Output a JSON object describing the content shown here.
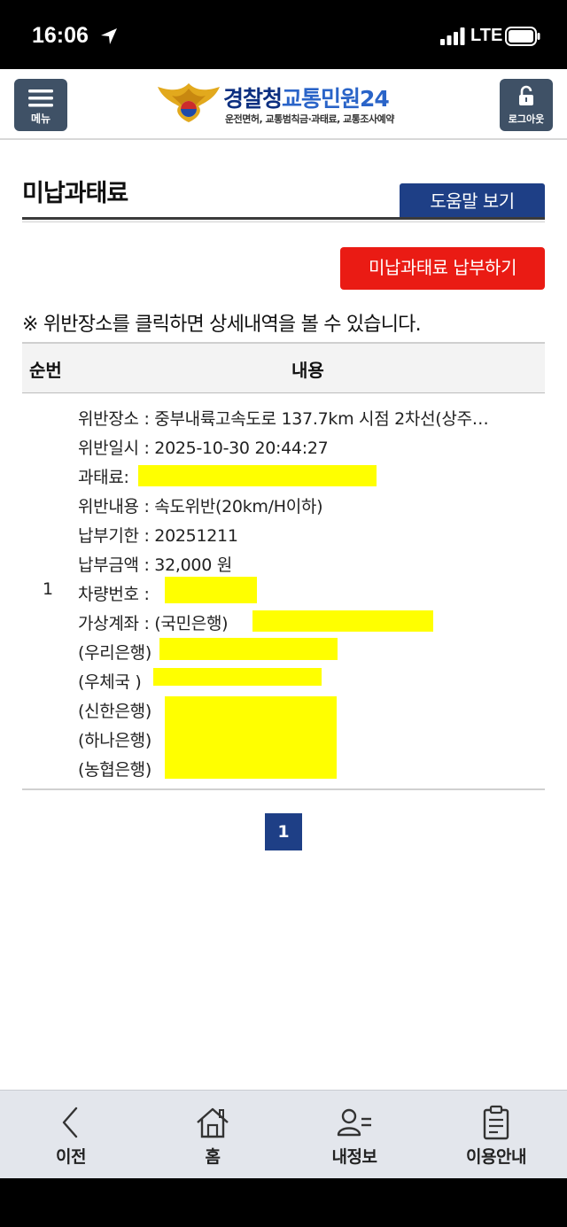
{
  "status": {
    "time": "16:06",
    "network": "LTE"
  },
  "header": {
    "menu_label": "메뉴",
    "logo_title_1": "경찰청",
    "logo_title_2": "교통민원24",
    "logo_subtitle": "운전면허, 교통범칙금·과태료, 교통조사예약",
    "logout_label": "로그아웃"
  },
  "page": {
    "title": "미납과태료",
    "help_label": "도움말 보기",
    "pay_label": "미납과태료 납부하기",
    "notice": "※ 위반장소를 클릭하면 상세내역을 볼 수 있습니다."
  },
  "table": {
    "col_no": "순번",
    "col_content": "내용",
    "row_no": "1",
    "place": "위반장소 : 중부내륙고속도로 137.7km 시점 2차선(상주…",
    "datetime": "위반일시 : 2025-10-30 20:44:27",
    "fine_label": "과태료:",
    "violation": "위반내용 : 속도위반(20km/H이하)",
    "due_date": "납부기한 : 20251211",
    "amount": "납부금액 : 32,000 원",
    "plate_label": "차량번호 :",
    "account_label": "가상계좌 : (국민은행)",
    "bank_woori": "(우리은행)",
    "bank_post": "(우체국 )",
    "bank_shinhan": "(신한은행)",
    "bank_hana": "(하나은행)",
    "bank_nh": "(농협은행)"
  },
  "pagination": {
    "current": "1"
  },
  "nav": {
    "back": "이전",
    "home": "홈",
    "my_info": "내정보",
    "guide": "이용안내"
  },
  "colors": {
    "brand_blue": "#1e3f86",
    "pay_red": "#ea1b14",
    "redaction": "#ffff00"
  }
}
